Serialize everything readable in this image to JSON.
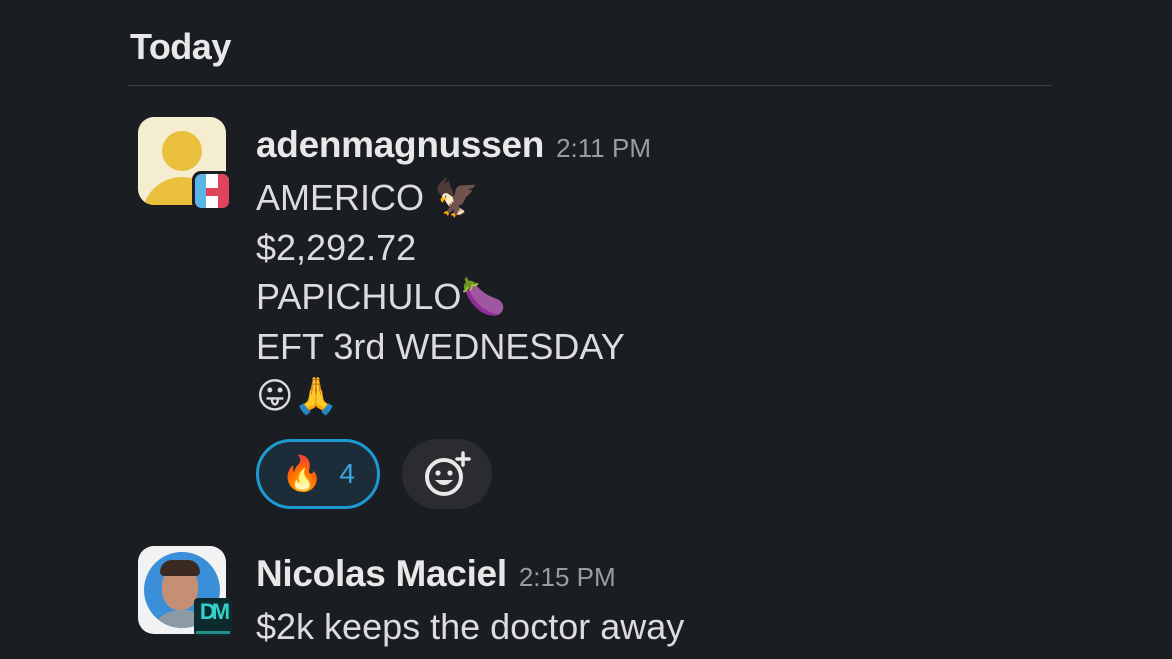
{
  "date_header": "Today",
  "messages": [
    {
      "sender": "adenmagnussen",
      "time": "2:11 PM",
      "lines": [
        {
          "text": "AMERICO",
          "emoji": "🦅"
        },
        {
          "text": "$2,292.72",
          "emoji": ""
        },
        {
          "text": "PAPICHULO",
          "emoji": "🍆"
        },
        {
          "text": "EFT 3rd WEDNESDAY",
          "emoji": ""
        },
        {
          "text": "",
          "emoji": "😛🙏"
        }
      ],
      "reactions": [
        {
          "emoji": "🔥",
          "count": "4",
          "selected": true
        }
      ],
      "add_reaction_icon": "add-reaction-icon"
    },
    {
      "sender": "Nicolas Maciel",
      "time": "2:15 PM",
      "lines": [
        {
          "text": "$2k keeps the doctor away",
          "emoji": ""
        }
      ]
    }
  ],
  "colors": {
    "background": "#1a1d21",
    "reaction_border": "#1d9bd1",
    "reaction_count": "#3aa7e0",
    "timestamp": "#9b9c9e"
  }
}
